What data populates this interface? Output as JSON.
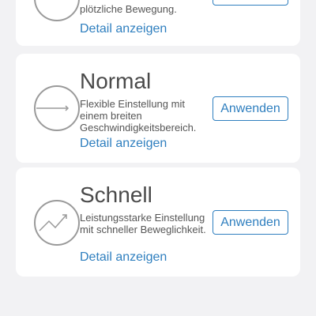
{
  "cards": [
    {
      "description": "plötzliche Bewegung.",
      "detail_label": "Detail anzeigen"
    },
    {
      "title": "Normal",
      "description": "Flexible Einstellung mit einem breiten Geschwindigkeitsbereich.",
      "detail_label": "Detail anzeigen",
      "apply_label": "Anwenden",
      "icon": "arrow-line-icon"
    },
    {
      "title": "Schnell",
      "description": "Leistungsstarke Einstellung mit schneller Beweglichkeit.",
      "detail_label": "Detail anzeigen",
      "apply_label": "Anwenden",
      "icon": "zigzag-arrow-icon"
    }
  ],
  "colors": {
    "accent": "#2f7fbf",
    "icon_stroke": "#9a9a9a",
    "background": "#f2f2f4"
  }
}
